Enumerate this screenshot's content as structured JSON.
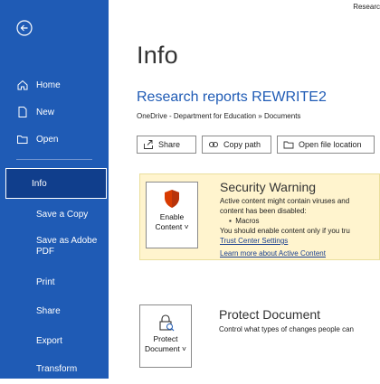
{
  "window": {
    "title_partial": "Researc"
  },
  "sidebar": {
    "items": [
      {
        "label": "Home"
      },
      {
        "label": "New"
      },
      {
        "label": "Open"
      },
      {
        "label": "Info"
      },
      {
        "label": "Save a Copy"
      },
      {
        "label": "Save as Adobe PDF"
      },
      {
        "label": "Print"
      },
      {
        "label": "Share"
      },
      {
        "label": "Export"
      },
      {
        "label": "Transform"
      }
    ]
  },
  "info": {
    "title": "Info",
    "doc_title": "Research reports REWRITE2",
    "path": "OneDrive - Department for Education » Documents",
    "buttons": {
      "share": "Share",
      "copy_path": "Copy path",
      "open_location": "Open file location"
    }
  },
  "security": {
    "button_line1": "Enable",
    "button_line2": "Content ˅",
    "heading": "Security Warning",
    "line1": "Active content might contain viruses and",
    "line2": "content has been disabled:",
    "bullet": "Macros",
    "line3": "You should enable content only if you tru",
    "link1": "Trust Center Settings",
    "link2": "Learn more about Active Content"
  },
  "protect": {
    "button_line1": "Protect",
    "button_line2": "Document ˅",
    "heading": "Protect Document",
    "desc": "Control what types of changes people can"
  },
  "colors": {
    "sidebar": "#1f5bb5",
    "accent": "#1f5bb5",
    "warning_bg": "#fff4ce",
    "shield": "#d83b01"
  }
}
